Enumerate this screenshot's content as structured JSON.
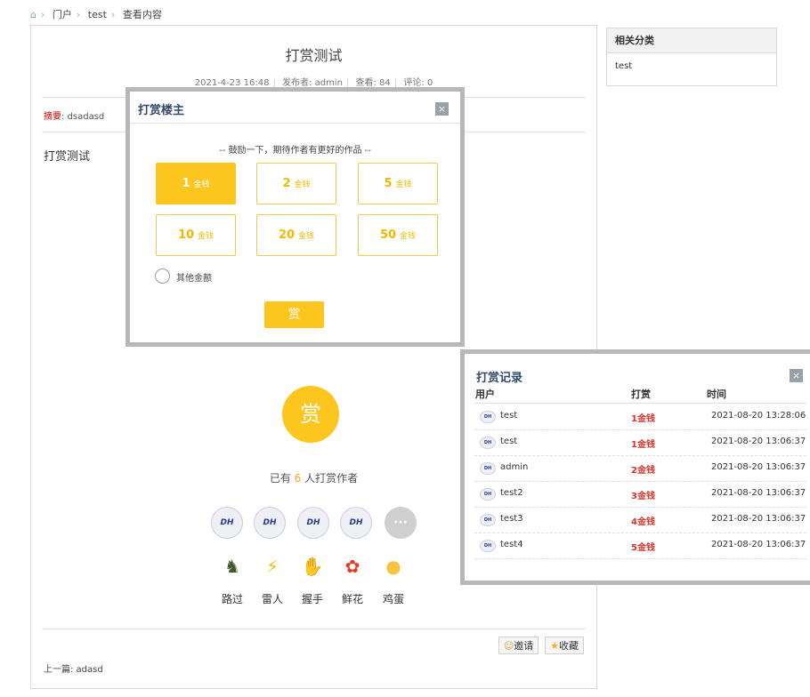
{
  "breadcrumb": {
    "items": [
      "门户",
      "test",
      "查看内容"
    ]
  },
  "article": {
    "title": "打赏测试",
    "date": "2021-4-23 16:48",
    "author": "发布者: admin",
    "views": "查看: 84",
    "comments": "评论: 0",
    "summary_label": "摘要",
    "summary_value": ": dsadasd",
    "body": "打赏测试",
    "reward_icon": "赏",
    "tip_prefix": "已有",
    "tip_count": "6",
    "tip_suffix": "人打赏作者",
    "avatar_logo": "DH",
    "avatar_more": "···",
    "reactions": [
      {
        "label": "路过",
        "icon": "soldier-icon",
        "glyph": "♞",
        "color": "#3d5a2a"
      },
      {
        "label": "雷人",
        "icon": "lightning-icon",
        "glyph": "⚡",
        "color": "#f0c010"
      },
      {
        "label": "握手",
        "icon": "handshake-icon",
        "glyph": "✋",
        "color": "#e0a070"
      },
      {
        "label": "鲜花",
        "icon": "flower-icon",
        "glyph": "✿",
        "color": "#e83a1e"
      },
      {
        "label": "鸡蛋",
        "icon": "egg-icon",
        "glyph": "●",
        "color": "#f5c542"
      }
    ],
    "invite_label": "邀请",
    "favorite_label": "收藏",
    "prev_label": "上一篇: adasd"
  },
  "sidebar": {
    "title": "相关分类",
    "item": "test"
  },
  "reward_dialog": {
    "title": "打赏楼主",
    "subtitle": "-- 鼓励一下，期待作者有更好的作品 --",
    "unit": "金钱",
    "amounts": [
      "1",
      "2",
      "5",
      "10",
      "20",
      "50"
    ],
    "selected_index": 0,
    "other_label": "其他金额",
    "submit_label": "赏",
    "close": "×"
  },
  "records_dialog": {
    "title": "打赏记录",
    "close": "×",
    "col_user": "用户",
    "col_amount": "打赏",
    "col_time": "时间",
    "rows": [
      {
        "user": "test",
        "amount": "1金钱",
        "time": "2021-08-20 13:28:06"
      },
      {
        "user": "test",
        "amount": "1金钱",
        "time": "2021-08-20 13:06:37"
      },
      {
        "user": "admin",
        "amount": "2金钱",
        "time": "2021-08-20 13:06:37"
      },
      {
        "user": "test2",
        "amount": "3金钱",
        "time": "2021-08-20 13:06:37"
      },
      {
        "user": "test3",
        "amount": "4金钱",
        "time": "2021-08-20 13:06:37"
      },
      {
        "user": "test4",
        "amount": "5金钱",
        "time": "2021-08-20 13:06:37"
      }
    ]
  },
  "colors": {
    "accent": "#fcc61e",
    "amount_red": "#d9342b",
    "dialog_border": "#b8b8b8"
  }
}
